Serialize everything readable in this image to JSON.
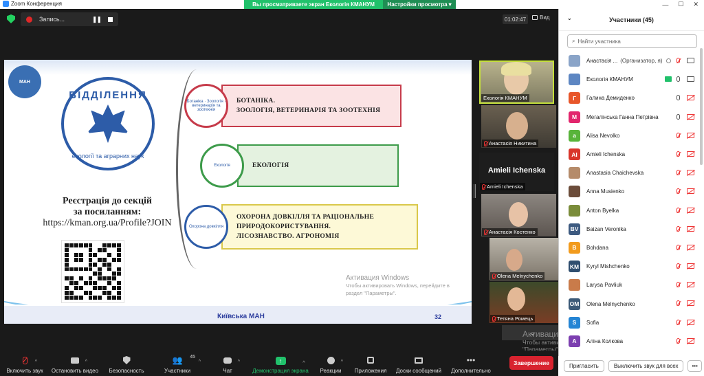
{
  "window": {
    "title": "Zoom Конференция",
    "min": "—",
    "max": "☐",
    "close": "✕"
  },
  "view_banner": {
    "message": "Вы просматриваете экран Екологія КМАНУМ",
    "options": "Настройки просмотра",
    "options_caret": "▾"
  },
  "recording": {
    "label": "Запись...",
    "pause": "❚❚"
  },
  "timer": "01:02:47",
  "view": "Вид",
  "slide": {
    "man_logo": "МАН",
    "dept_top": "ВІДДІЛЕННЯ",
    "dept_bottom": "екології та аграрних наук",
    "reg_line1": "Реєстрація до секцій",
    "reg_line2": "за посиланням:",
    "reg_url": "https://kman.org.ua/Profile?JOIN",
    "sec1_circ": "Ботаніка · Зоологія · ветеринарія та зоотехнія",
    "sec1_line1": "БОТАНІКА.",
    "sec1_line2": "ЗООЛОГІЯ, ВЕТЕРИНАРІЯ ТА ЗООТЕХНІЯ",
    "sec2_circ": "Екологія",
    "sec2_line1": "ЕКОЛОГІЯ",
    "sec3_circ": "Охорона довкілля",
    "sec3_line1": "ОХОРОНА ДОВКІЛЛЯ ТА РАЦІОНАЛЬНЕ",
    "sec3_line2": "ПРИРОДОКОРИСТУВАННЯ.",
    "sec3_line3": "ЛІСОЗНАВСТВО. АГРОНОМІЯ",
    "footer_org": "Київська МАН",
    "page": "32",
    "activation_title": "Активация Windows",
    "activation_sub1": "Чтобы активировать Windows, перейдите в",
    "activation_sub2": "раздел \"Параметры\"."
  },
  "videos": [
    {
      "name": "Екологія КМАНУМ"
    },
    {
      "name": "Анастасія Никитина"
    },
    {
      "name": "Amieli Ichenska",
      "big": "Amieli Ichenska"
    },
    {
      "name": "Анастасія Костенко"
    },
    {
      "name": "Olena Melnychenko"
    },
    {
      "name": "Тетяна Ромець"
    }
  ],
  "toolbar": {
    "mute": "Включить звук",
    "video": "Остановить видео",
    "security": "Безопасность",
    "participants": "Участники",
    "participants_count": "45",
    "chat": "Чат",
    "share": "Демонстрация экрана",
    "reactions": "Реакции",
    "apps": "Приложения",
    "whiteboards": "Доски сообщений",
    "more": "Дополнительно",
    "end": "Завершение"
  },
  "activation_overlay": {
    "title": "Активация Windows",
    "sub1": "Чтобы активировать Windows, перейдите в раздел",
    "sub2": "\"Параметры\"."
  },
  "panel": {
    "title": "Участники (45)",
    "search_placeholder": "Найти участника",
    "invite": "Пригласить",
    "mute_all": "Выключить звук для всех",
    "participants": [
      {
        "name": "Анастасія ...",
        "role": "(Организатор, я)",
        "initial": "",
        "color": "#8aa4c8"
      },
      {
        "name": "Екологія КМАНУМ",
        "role": "",
        "initial": "",
        "color": "#5d86c2"
      },
      {
        "name": "Галина Демиденко",
        "role": "",
        "initial": "Г",
        "color": "#e8562a"
      },
      {
        "name": "Мегалінська Ганна Петрівна",
        "role": "",
        "initial": "М",
        "color": "#e2266d"
      },
      {
        "name": "Alisa Nevolko",
        "role": "",
        "initial": "a",
        "color": "#58b43a"
      },
      {
        "name": "Amieli Ichenska",
        "role": "",
        "initial": "AI",
        "color": "#d9362b"
      },
      {
        "name": "Anastasia Chaichevska",
        "role": "",
        "initial": "",
        "color": "#b58b6a"
      },
      {
        "name": "Anna Musienko",
        "role": "",
        "initial": "",
        "color": "#6b4c3a"
      },
      {
        "name": "Anton Byelka",
        "role": "",
        "initial": "",
        "color": "#7a8c3a"
      },
      {
        "name": "Baizan Veronika",
        "role": "",
        "initial": "BV",
        "color": "#3d5a80"
      },
      {
        "name": "Bohdana",
        "role": "",
        "initial": "B",
        "color": "#f29b1d"
      },
      {
        "name": "Kyryl Mishchenko",
        "role": "",
        "initial": "KM",
        "color": "#2f4e6f"
      },
      {
        "name": "Larysa Pavliuk",
        "role": "",
        "initial": "",
        "color": "#c97b4a"
      },
      {
        "name": "Olena Melnychenko",
        "role": "",
        "initial": "OM",
        "color": "#3c5a78"
      },
      {
        "name": "Sofia",
        "role": "",
        "initial": "S",
        "color": "#2585d4"
      },
      {
        "name": "Аліна Колкова",
        "role": "",
        "initial": "A",
        "color": "#7c3fb0"
      }
    ]
  }
}
